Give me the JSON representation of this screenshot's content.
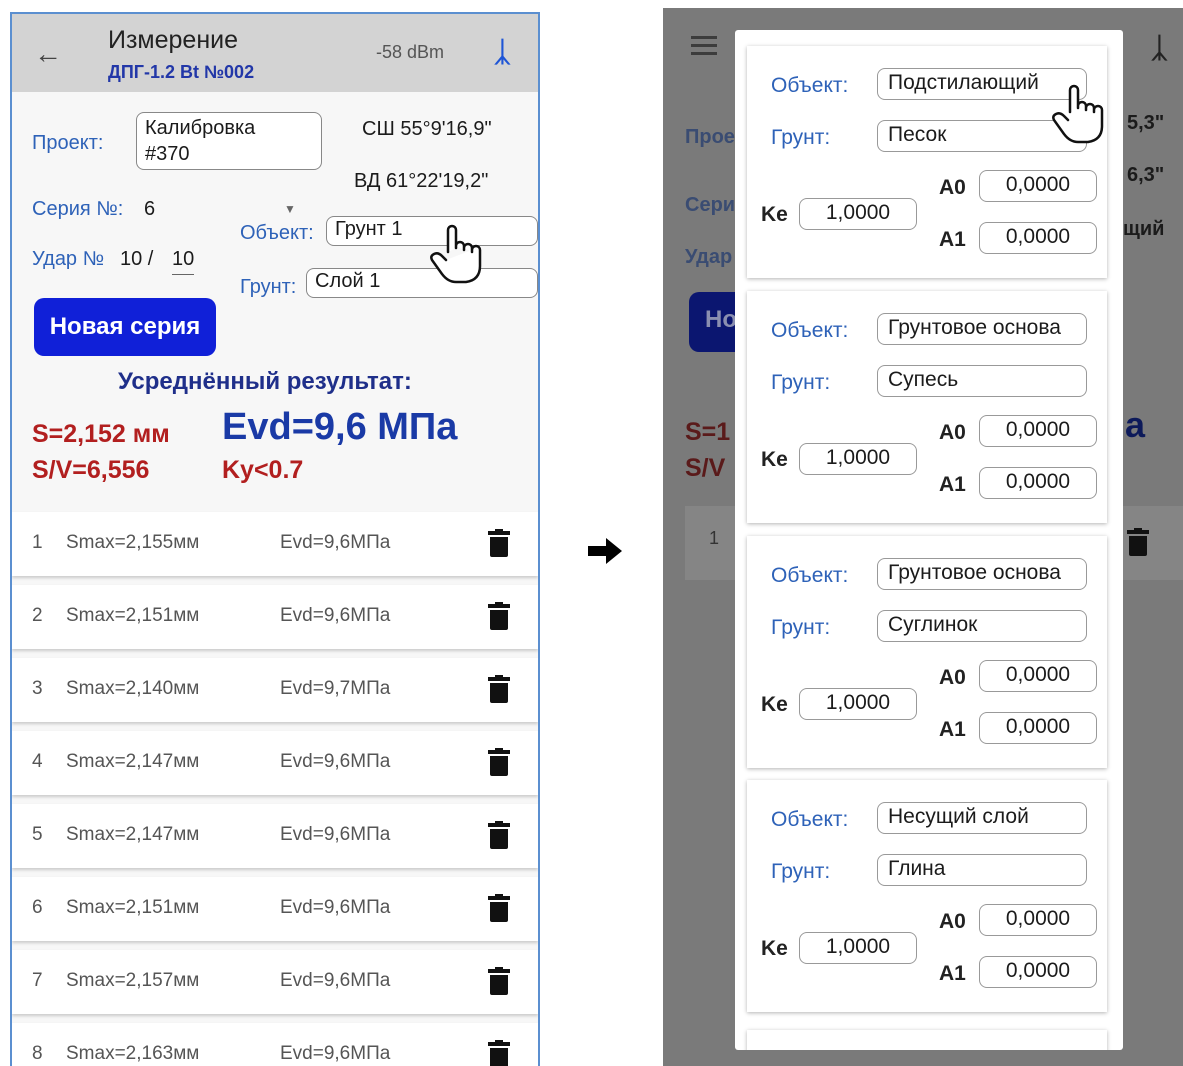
{
  "left": {
    "appbar": {
      "back_icon": "arrow-left-icon",
      "title": "Измерение",
      "subtitle": "ДПГ-1.2 Bt №002",
      "signal": "-58 dBm",
      "bluetooth_icon": "bluetooth-icon"
    },
    "project_label": "Проект:",
    "project_value_line1": "Калибровка",
    "project_value_line2": "#370",
    "lat": "СШ 55°9'16,9\"",
    "lon": "ВД 61°22'19,2\"",
    "series_label": "Серия №:",
    "series_value": "6",
    "hit_label": "Удар №",
    "hit_value": "10 /",
    "hit_total": "10",
    "object_label": "Объект:",
    "object_value": "Грунт 1",
    "soil_label": "Грунт:",
    "soil_value": "Слой 1",
    "new_series": "Новая серия",
    "avg_title": "Усреднённый результат:",
    "s": "S=2,152 мм",
    "sv": "S/V=6,556",
    "evd": "Evd=9,6 МПа",
    "ky": "Ky<0.7",
    "rows": [
      {
        "n": "1",
        "smax": "Smax=2,155мм",
        "evd": "Evd=9,6МПа"
      },
      {
        "n": "2",
        "smax": "Smax=2,151мм",
        "evd": "Evd=9,6МПа"
      },
      {
        "n": "3",
        "smax": "Smax=2,140мм",
        "evd": "Evd=9,7МПа"
      },
      {
        "n": "4",
        "smax": "Smax=2,147мм",
        "evd": "Evd=9,6МПа"
      },
      {
        "n": "5",
        "smax": "Smax=2,147мм",
        "evd": "Evd=9,6МПа"
      },
      {
        "n": "6",
        "smax": "Smax=2,151мм",
        "evd": "Evd=9,6МПа"
      },
      {
        "n": "7",
        "smax": "Smax=2,157мм",
        "evd": "Evd=9,6МПа"
      },
      {
        "n": "8",
        "smax": "Smax=2,163мм",
        "evd": "Evd=9,6МПа"
      }
    ]
  },
  "right": {
    "menu_icon": "menu-icon",
    "behind": {
      "proe": "Прое",
      "seri": "Сери",
      "udar": "Удар",
      "no": "Но",
      "s1": "S=1",
      "sv": "S/V",
      "row1": "1",
      "c1": "5,3\"",
      "c2": "6,3\"",
      "c3": "щий",
      "c4": "а"
    },
    "labels": {
      "object": "Объект:",
      "soil": "Грунт:",
      "ke": "Ke",
      "a0": "A0",
      "a1": "A1"
    },
    "cards": [
      {
        "object": "Подстилающий",
        "soil": "Песок",
        "ke": "1,0000",
        "a0": "0,0000",
        "a1": "0,0000"
      },
      {
        "object": "Грунтовое основа",
        "soil": "Супесь",
        "ke": "1,0000",
        "a0": "0,0000",
        "a1": "0,0000"
      },
      {
        "object": "Грунтовое основа",
        "soil": "Суглинок",
        "ke": "1,0000",
        "a0": "0,0000",
        "a1": "0,0000"
      },
      {
        "object": "Несущий слой",
        "soil": "Глина",
        "ke": "1,0000",
        "a0": "0,0000",
        "a1": "0,0000"
      }
    ]
  },
  "arrow_icon": "arrow-right-icon",
  "pointer_icon": "hand-pointer-icon"
}
